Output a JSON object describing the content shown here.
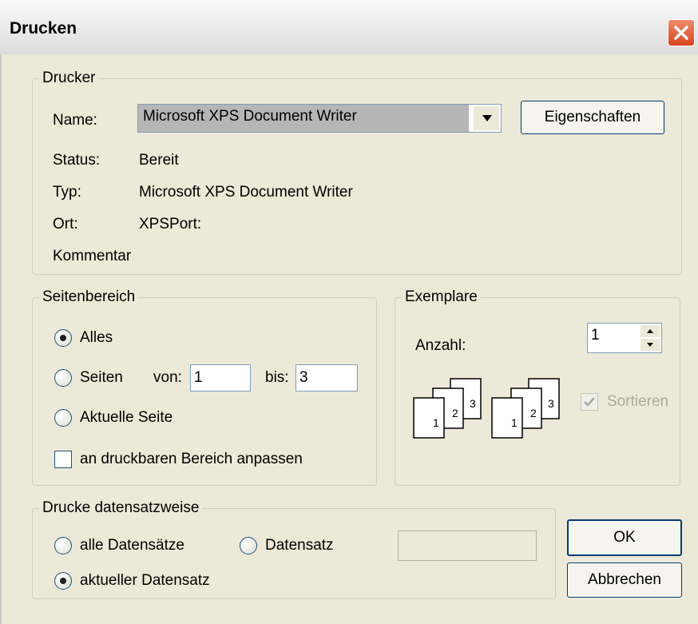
{
  "window": {
    "title": "Drucken"
  },
  "printer": {
    "legend": "Drucker",
    "name_label": "Name:",
    "name_value": "Microsoft XPS Document Writer",
    "properties_button": "Eigenschaften",
    "status_label": "Status:",
    "status_value": "Bereit",
    "type_label": "Typ:",
    "type_value": "Microsoft XPS Document Writer",
    "location_label": "Ort:",
    "location_value": "XPSPort:",
    "comment_label": "Kommentar"
  },
  "page_range": {
    "legend": "Seitenbereich",
    "all_label": "Alles",
    "pages_label": "Seiten",
    "from_label": "von:",
    "from_value": "1",
    "to_label": "bis:",
    "to_value": "3",
    "current_label": "Aktuelle Seite",
    "fit_label": "an druckbaren Bereich anpassen",
    "selected": "all",
    "fit_checked": false
  },
  "copies": {
    "legend": "Exemplare",
    "count_label": "Anzahl:",
    "count_value": "1",
    "collate_label": "Sortieren",
    "collate_checked": true,
    "collate_enabled": false,
    "page_numbers": [
      "1",
      "2",
      "3"
    ]
  },
  "records": {
    "legend": "Drucke datensatzweise",
    "all_records_label": "alle Datensätze",
    "record_label": "Datensatz",
    "current_record_label": "aktueller Datensatz",
    "selected": "current"
  },
  "buttons": {
    "ok": "OK",
    "cancel": "Abbrechen"
  },
  "colors": {
    "dialog_bg": "#ece9d8",
    "close_button": "#d8451d",
    "combo_selection": "#b6b6b6"
  }
}
